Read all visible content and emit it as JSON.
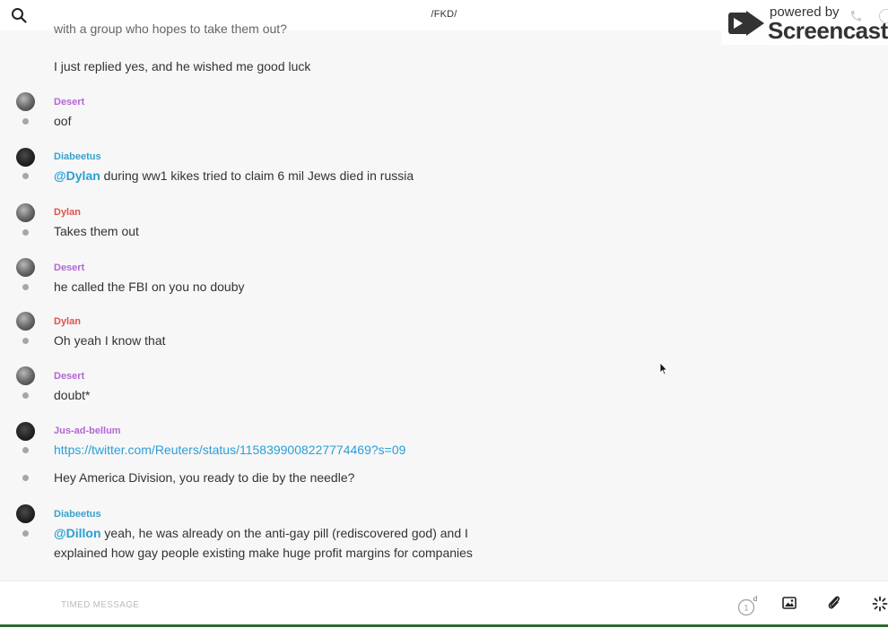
{
  "header": {
    "channel": "/FKD/",
    "search_icon": "search-icon"
  },
  "watermark": {
    "powered_by": "powered by",
    "brand": "Screencastify"
  },
  "messages": [
    {
      "sender": "",
      "color": "",
      "avatar": "",
      "text": "with a group who hopes to take them out?"
    },
    {
      "sender": "",
      "color": "",
      "avatar": "",
      "text": "I just replied yes, and he wished me good luck"
    },
    {
      "sender": "Desert",
      "color": "#b565d6",
      "avatar": "desert-avatar",
      "text": "oof"
    },
    {
      "sender": "Diabeetus",
      "color": "#3aa2cc",
      "avatar": "diabeetus-avatar",
      "mention": "@Dylan",
      "text": " during ww1 kikes tried to claim 6 mil Jews died in russia"
    },
    {
      "sender": "Dylan",
      "color": "#e0524a",
      "avatar": "dylan-avatar",
      "text": "Takes them out"
    },
    {
      "sender": "Desert",
      "color": "#b565d6",
      "avatar": "desert-avatar",
      "text": "he called the FBI on you no douby"
    },
    {
      "sender": "Dylan",
      "color": "#e0524a",
      "avatar": "dylan-avatar",
      "text": "Oh yeah I know that"
    },
    {
      "sender": "Desert",
      "color": "#b565d6",
      "avatar": "desert-avatar",
      "text": "doubt*"
    },
    {
      "sender": "Jus-ad-bellum",
      "color": "#b565d6",
      "avatar": "jus-ad-bellum-avatar",
      "link": "https://twitter.com/Reuters/status/1158399008227774469?s=09"
    },
    {
      "sender": "",
      "color": "",
      "avatar": "",
      "text": "Hey America Division, you ready to die by the needle?"
    },
    {
      "sender": "Diabeetus",
      "color": "#3aa2cc",
      "avatar": "diabeetus-avatar",
      "mention": "@Dillon",
      "text": " yeah, he was already on the anti-gay pill (rediscovered god) and I",
      "text_line2": "explained how gay people existing make huge profit margins for companies"
    }
  ],
  "compose": {
    "placeholder": "TIMED MESSAGE",
    "timer_value": "1",
    "timer_unit": "d"
  }
}
